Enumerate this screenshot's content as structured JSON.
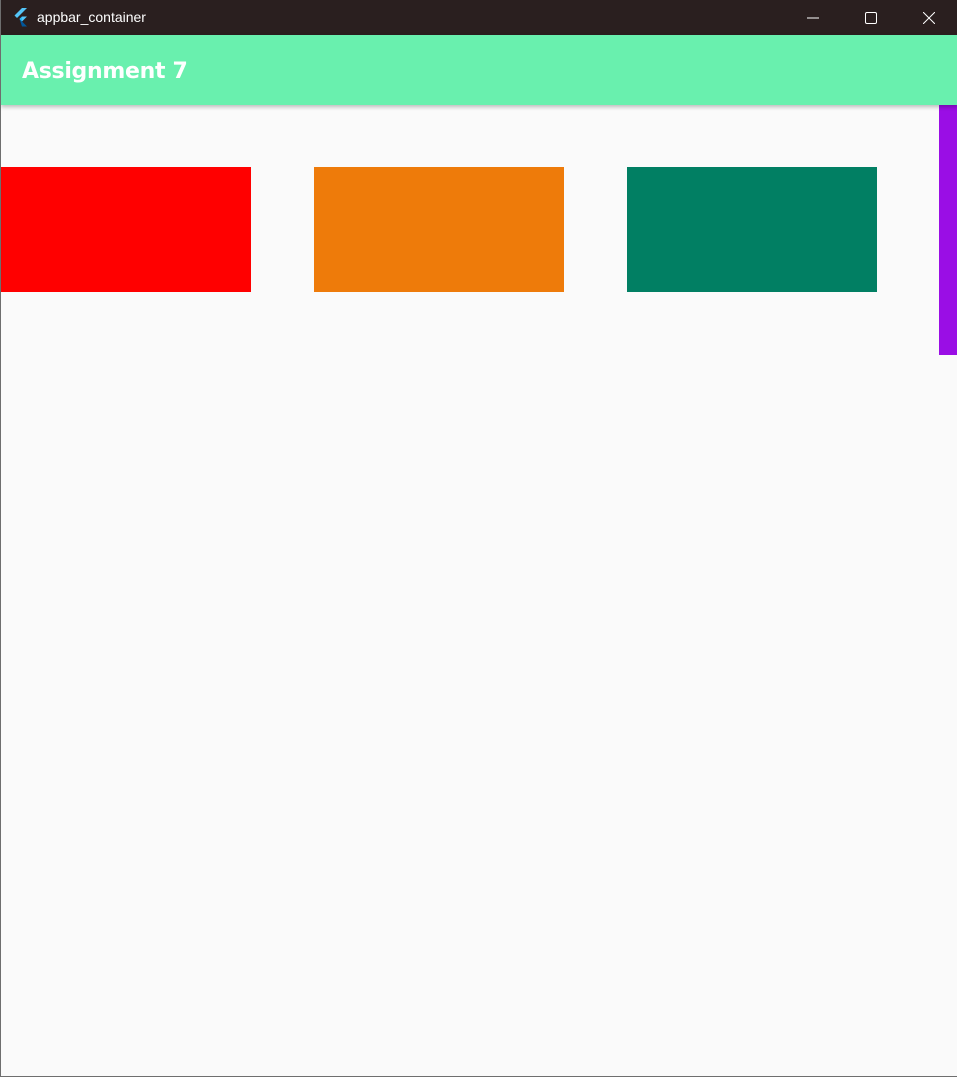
{
  "window": {
    "title": "appbar_container",
    "icon": "flutter-logo-icon",
    "controls": {
      "minimize_icon": "minimize-icon",
      "maximize_icon": "maximize-icon",
      "close_icon": "close-icon"
    },
    "titlebar_color": "#2a1f1f"
  },
  "appbar": {
    "title": "Assignment 7",
    "color": "#69f0ae"
  },
  "content": {
    "background": "#fafafa",
    "containers": [
      {
        "color": "#ff0000"
      },
      {
        "color": "#ee7b0a"
      },
      {
        "color": "#017f63"
      }
    ],
    "side_container": {
      "color": "#9a0ee5"
    }
  }
}
